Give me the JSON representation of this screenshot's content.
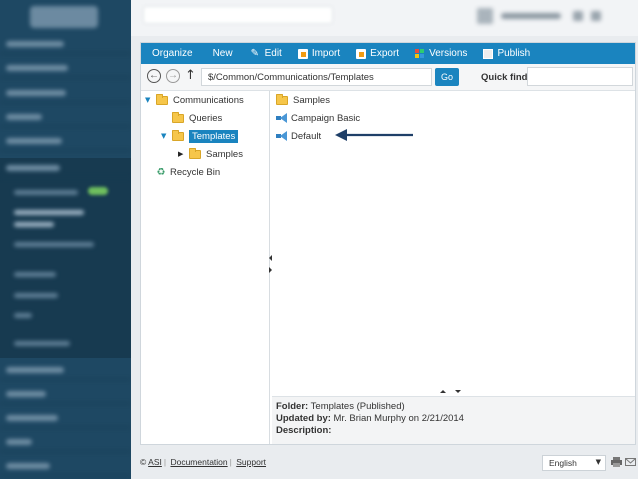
{
  "toolbar": {
    "organize": "Organize",
    "new": "New",
    "edit": "Edit",
    "import": "Import",
    "export": "Export",
    "versions": "Versions",
    "publish": "Publish"
  },
  "address": {
    "path": "$/Common/Communications/Templates",
    "go_label": "Go",
    "quick_find_label": "Quick find",
    "quick_find_value": ""
  },
  "tree": {
    "root": "Communications",
    "queries": "Queries",
    "templates": "Templates",
    "samples": "Samples",
    "recycle_bin": "Recycle Bin"
  },
  "list": {
    "items": [
      {
        "label": "Samples",
        "icon": "folder-icon"
      },
      {
        "label": "Campaign Basic",
        "icon": "campaign-icon"
      },
      {
        "label": "Default",
        "icon": "campaign-icon"
      }
    ]
  },
  "details": {
    "folder_label": "Folder:",
    "folder_value": "Templates (Published)",
    "updated_label": "Updated by:",
    "updated_value": "Mr. Brian Murphy on 2/21/2014",
    "description_label": "Description:",
    "description_value": ""
  },
  "footer": {
    "copyright": "©",
    "asi": "ASI",
    "documentation": "Documentation",
    "support": "Support",
    "language": "English"
  },
  "colors": {
    "toolbar_blue": "#1a84bf",
    "nav_dark": "#1e4863",
    "arrow": "#1f3f68"
  }
}
